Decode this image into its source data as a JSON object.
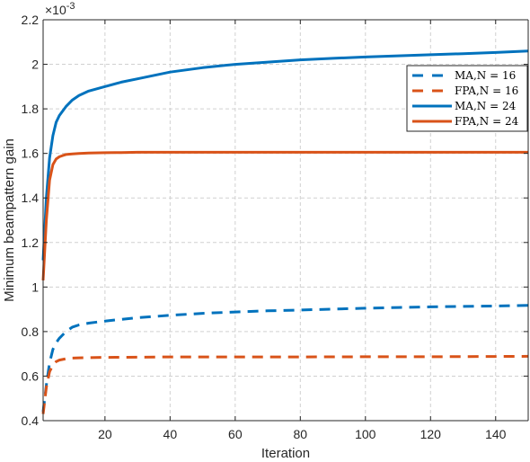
{
  "chart_data": {
    "type": "line",
    "title": "",
    "xlabel": "Iteration",
    "ylabel": "Minimum beampattern gain",
    "y_exponent_label": "×10",
    "y_exponent_power": "-3",
    "xlim": [
      1,
      150
    ],
    "ylim": [
      0.4,
      2.2
    ],
    "xticks": [
      20,
      40,
      60,
      80,
      100,
      120,
      140
    ],
    "xtick_labels": [
      "20",
      "40",
      "60",
      "80",
      "100",
      "120",
      "140"
    ],
    "yticks": [
      0.4,
      0.6,
      0.8,
      1.0,
      1.2,
      1.4,
      1.6,
      1.8,
      2.0,
      2.2
    ],
    "ytick_labels": [
      "0.4",
      "0.6",
      "0.8",
      "1",
      "1.2",
      "1.4",
      "1.6",
      "1.8",
      "2",
      "2.2"
    ],
    "grid": true,
    "legend_position": "top-right",
    "series": [
      {
        "name": "MA, N = 16",
        "legend_label": "MA,N = 16",
        "color": "#0072BD",
        "style": "dashed",
        "x": [
          1,
          2,
          3,
          4,
          5,
          6,
          8,
          10,
          12,
          15,
          20,
          25,
          30,
          40,
          50,
          60,
          70,
          80,
          90,
          100,
          110,
          120,
          130,
          140,
          150
        ],
        "y": [
          0.44,
          0.56,
          0.66,
          0.72,
          0.75,
          0.77,
          0.8,
          0.82,
          0.83,
          0.838,
          0.847,
          0.855,
          0.862,
          0.873,
          0.882,
          0.888,
          0.893,
          0.897,
          0.901,
          0.905,
          0.908,
          0.911,
          0.913,
          0.915,
          0.918
        ]
      },
      {
        "name": "FPA, N = 16",
        "legend_label": "FPA,N = 16",
        "color": "#D95319",
        "style": "dashed",
        "x": [
          1,
          2,
          3,
          4,
          5,
          6,
          8,
          10,
          12,
          15,
          20,
          30,
          40,
          60,
          80,
          100,
          120,
          140,
          150
        ],
        "y": [
          0.43,
          0.55,
          0.62,
          0.65,
          0.665,
          0.672,
          0.678,
          0.681,
          0.682,
          0.683,
          0.684,
          0.685,
          0.686,
          0.686,
          0.686,
          0.687,
          0.687,
          0.688,
          0.689
        ]
      },
      {
        "name": "MA, N = 24",
        "legend_label": "MA,N = 24",
        "color": "#0072BD",
        "style": "solid",
        "x": [
          1,
          2,
          3,
          4,
          5,
          6,
          7,
          8,
          10,
          12,
          15,
          20,
          25,
          30,
          40,
          50,
          60,
          70,
          80,
          90,
          100,
          110,
          120,
          130,
          140,
          150
        ],
        "y": [
          1.12,
          1.4,
          1.58,
          1.68,
          1.74,
          1.77,
          1.79,
          1.81,
          1.84,
          1.86,
          1.88,
          1.9,
          1.92,
          1.935,
          1.965,
          1.985,
          2.0,
          2.01,
          2.02,
          2.027,
          2.033,
          2.038,
          2.043,
          2.048,
          2.053,
          2.06
        ]
      },
      {
        "name": "FPA, N = 24",
        "legend_label": "FPA,N = 24",
        "color": "#D95319",
        "style": "solid",
        "x": [
          1,
          2,
          3,
          4,
          5,
          6,
          7,
          8,
          10,
          12,
          15,
          20,
          25,
          30,
          40,
          60,
          80,
          100,
          120,
          140,
          150
        ],
        "y": [
          1.03,
          1.3,
          1.48,
          1.55,
          1.575,
          1.585,
          1.59,
          1.595,
          1.598,
          1.6,
          1.602,
          1.603,
          1.604,
          1.605,
          1.605,
          1.605,
          1.605,
          1.605,
          1.605,
          1.605,
          1.605
        ]
      }
    ]
  }
}
